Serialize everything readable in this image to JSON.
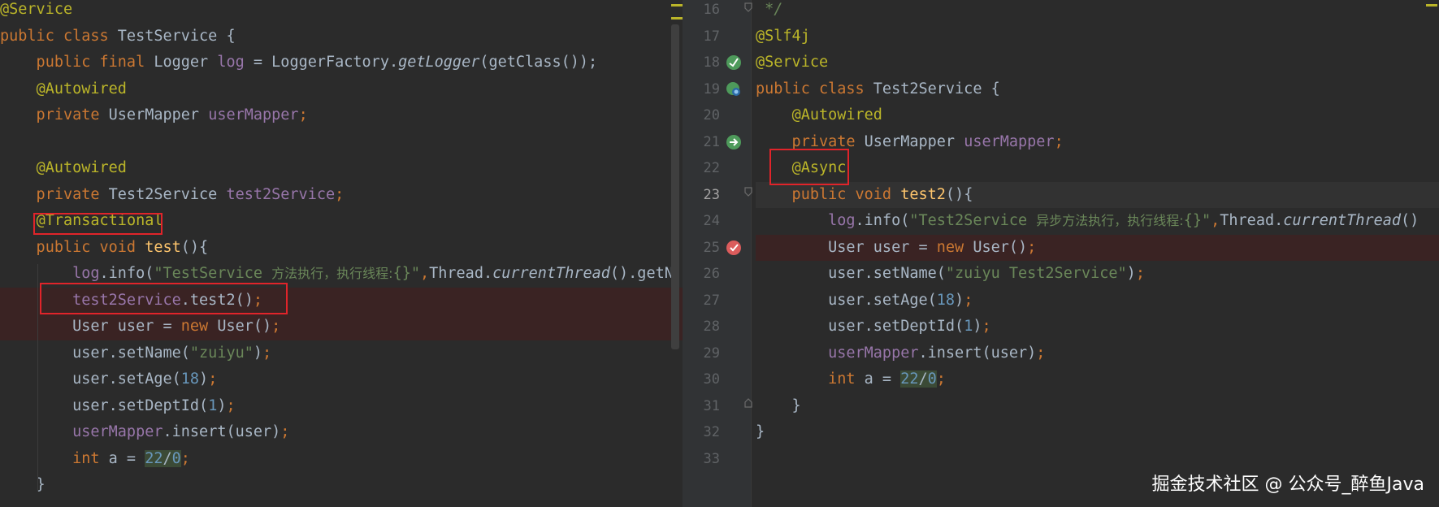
{
  "left_editor": {
    "lines": [
      {
        "tokens": [
          {
            "t": "@Service",
            "c": "ann"
          }
        ]
      },
      {
        "tokens": [
          {
            "t": "public class ",
            "c": "kw"
          },
          {
            "t": "TestService {",
            "c": "plain"
          }
        ]
      },
      {
        "tokens": [
          {
            "t": "    public final ",
            "c": "kw"
          },
          {
            "t": "Logger ",
            "c": "plain"
          },
          {
            "t": "log",
            "c": "fld"
          },
          {
            "t": " = LoggerFactory.",
            "c": "plain"
          },
          {
            "t": "getLogger",
            "c": "plain ital"
          },
          {
            "t": "(getClass());",
            "c": "plain"
          }
        ]
      },
      {
        "tokens": [
          {
            "t": "    ",
            "c": "plain"
          },
          {
            "t": "@Autowired",
            "c": "ann"
          }
        ]
      },
      {
        "tokens": [
          {
            "t": "    private ",
            "c": "kw"
          },
          {
            "t": "UserMapper ",
            "c": "plain"
          },
          {
            "t": "userMapper",
            "c": "fld"
          },
          {
            "t": ";",
            "c": "kw"
          }
        ]
      },
      {
        "tokens": []
      },
      {
        "tokens": [
          {
            "t": "    ",
            "c": "plain"
          },
          {
            "t": "@Autowired",
            "c": "ann"
          }
        ]
      },
      {
        "tokens": [
          {
            "t": "    private ",
            "c": "kw"
          },
          {
            "t": "Test2Service ",
            "c": "plain"
          },
          {
            "t": "test2Service",
            "c": "fld"
          },
          {
            "t": ";",
            "c": "kw"
          }
        ]
      },
      {
        "tokens": [
          {
            "t": "    ",
            "c": "plain"
          },
          {
            "t": "@Transactional",
            "c": "ann"
          }
        ]
      },
      {
        "tokens": [
          {
            "t": "    public void ",
            "c": "kw"
          },
          {
            "t": "test",
            "c": "fn"
          },
          {
            "t": "(){",
            "c": "plain"
          }
        ]
      },
      {
        "tokens": [
          {
            "t": "        ",
            "c": "plain"
          },
          {
            "t": "log",
            "c": "fld"
          },
          {
            "t": ".info(",
            "c": "plain"
          },
          {
            "t": "\"TestService ",
            "c": "str"
          },
          {
            "t": "方法执行，执行线程:",
            "c": "cn"
          },
          {
            "t": "{}\"",
            "c": "str"
          },
          {
            "t": ",",
            "c": "kw"
          },
          {
            "t": "Thread.",
            "c": "plain"
          },
          {
            "t": "currentThread",
            "c": "plain ital"
          },
          {
            "t": "().getN",
            "c": "plain"
          }
        ]
      },
      {
        "tokens": [
          {
            "t": "        ",
            "c": "plain"
          },
          {
            "t": "test2Service",
            "c": "fld"
          },
          {
            "t": ".test2()",
            "c": "plain"
          },
          {
            "t": ";",
            "c": "kw"
          }
        ],
        "bp": true
      },
      {
        "tokens": [
          {
            "t": "        User user = ",
            "c": "plain"
          },
          {
            "t": "new ",
            "c": "kw"
          },
          {
            "t": "User()",
            "c": "plain"
          },
          {
            "t": ";",
            "c": "kw"
          }
        ],
        "bp": true
      },
      {
        "tokens": [
          {
            "t": "        user.setName(",
            "c": "plain"
          },
          {
            "t": "\"zuiyu\"",
            "c": "str"
          },
          {
            "t": ")",
            "c": "plain"
          },
          {
            "t": ";",
            "c": "kw"
          }
        ]
      },
      {
        "tokens": [
          {
            "t": "        user.setAge(",
            "c": "plain"
          },
          {
            "t": "18",
            "c": "num"
          },
          {
            "t": ")",
            "c": "plain"
          },
          {
            "t": ";",
            "c": "kw"
          }
        ]
      },
      {
        "tokens": [
          {
            "t": "        user.setDeptId(",
            "c": "plain"
          },
          {
            "t": "1",
            "c": "num"
          },
          {
            "t": ")",
            "c": "plain"
          },
          {
            "t": ";",
            "c": "kw"
          }
        ]
      },
      {
        "tokens": [
          {
            "t": "        ",
            "c": "plain"
          },
          {
            "t": "userMapper",
            "c": "fld"
          },
          {
            "t": ".insert(user)",
            "c": "plain"
          },
          {
            "t": ";",
            "c": "kw"
          }
        ]
      },
      {
        "tokens": [
          {
            "t": "        int ",
            "c": "kw"
          },
          {
            "t": "a = ",
            "c": "plain"
          },
          {
            "t": "22",
            "c": "num hl-num"
          },
          {
            "t": "/",
            "c": "plain hl-num"
          },
          {
            "t": "0",
            "c": "num hl-num"
          },
          {
            "t": ";",
            "c": "kw"
          }
        ]
      },
      {
        "tokens": [
          {
            "t": "    }",
            "c": "plain"
          }
        ]
      }
    ]
  },
  "right_editor": {
    "line_numbers": [
      "16",
      "17",
      "18",
      "19",
      "20",
      "21",
      "22",
      "23",
      "24",
      "25",
      "26",
      "27",
      "28",
      "29",
      "30",
      "31",
      "32",
      "33"
    ],
    "current_line": "23",
    "lines": [
      {
        "tokens": [
          {
            "t": " */",
            "c": "str ital"
          }
        ]
      },
      {
        "tokens": [
          {
            "t": "@Slf4j",
            "c": "ann"
          }
        ]
      },
      {
        "tokens": [
          {
            "t": "@Service",
            "c": "ann"
          }
        ]
      },
      {
        "tokens": [
          {
            "t": "public class ",
            "c": "kw"
          },
          {
            "t": "Test2Service {",
            "c": "plain"
          }
        ]
      },
      {
        "tokens": [
          {
            "t": "    ",
            "c": "plain"
          },
          {
            "t": "@Autowired",
            "c": "ann"
          }
        ]
      },
      {
        "tokens": [
          {
            "t": "    private ",
            "c": "kw"
          },
          {
            "t": "UserMapper ",
            "c": "plain"
          },
          {
            "t": "userMapper",
            "c": "fld"
          },
          {
            "t": ";",
            "c": "kw"
          }
        ]
      },
      {
        "tokens": [
          {
            "t": "    ",
            "c": "plain"
          },
          {
            "t": "@Async",
            "c": "ann"
          }
        ]
      },
      {
        "tokens": [
          {
            "t": "    public void ",
            "c": "kw"
          },
          {
            "t": "test2",
            "c": "fn"
          },
          {
            "t": "(){",
            "c": "plain"
          }
        ],
        "cur": true
      },
      {
        "tokens": [
          {
            "t": "        ",
            "c": "plain"
          },
          {
            "t": "log",
            "c": "fld"
          },
          {
            "t": ".info(",
            "c": "plain"
          },
          {
            "t": "\"Test2Service ",
            "c": "str"
          },
          {
            "t": "异步方法执行，执行线程:",
            "c": "cn"
          },
          {
            "t": "{}\"",
            "c": "str"
          },
          {
            "t": ",",
            "c": "kw"
          },
          {
            "t": "Thread.",
            "c": "plain"
          },
          {
            "t": "currentThread",
            "c": "plain ital"
          },
          {
            "t": "()",
            "c": "plain"
          }
        ]
      },
      {
        "tokens": [
          {
            "t": "        User user = ",
            "c": "plain"
          },
          {
            "t": "new ",
            "c": "kw"
          },
          {
            "t": "User()",
            "c": "plain"
          },
          {
            "t": ";",
            "c": "kw"
          }
        ],
        "bp": true
      },
      {
        "tokens": [
          {
            "t": "        user.setName(",
            "c": "plain"
          },
          {
            "t": "\"zuiyu Test2Service\"",
            "c": "str"
          },
          {
            "t": ")",
            "c": "plain"
          },
          {
            "t": ";",
            "c": "kw"
          }
        ]
      },
      {
        "tokens": [
          {
            "t": "        user.setAge(",
            "c": "plain"
          },
          {
            "t": "18",
            "c": "num"
          },
          {
            "t": ")",
            "c": "plain"
          },
          {
            "t": ";",
            "c": "kw"
          }
        ]
      },
      {
        "tokens": [
          {
            "t": "        user.setDeptId(",
            "c": "plain"
          },
          {
            "t": "1",
            "c": "num"
          },
          {
            "t": ")",
            "c": "plain"
          },
          {
            "t": ";",
            "c": "kw"
          }
        ]
      },
      {
        "tokens": [
          {
            "t": "        ",
            "c": "plain"
          },
          {
            "t": "userMapper",
            "c": "fld"
          },
          {
            "t": ".insert(user)",
            "c": "plain"
          },
          {
            "t": ";",
            "c": "kw"
          }
        ]
      },
      {
        "tokens": [
          {
            "t": "        int ",
            "c": "kw"
          },
          {
            "t": "a = ",
            "c": "plain"
          },
          {
            "t": "22",
            "c": "num hl-num"
          },
          {
            "t": "/",
            "c": "plain hl-num"
          },
          {
            "t": "0",
            "c": "num hl-num"
          },
          {
            "t": ";",
            "c": "kw"
          }
        ]
      },
      {
        "tokens": [
          {
            "t": "    }",
            "c": "plain"
          }
        ]
      },
      {
        "tokens": [
          {
            "t": "}",
            "c": "plain"
          }
        ]
      },
      {
        "tokens": []
      }
    ],
    "gutter_icons": [
      {
        "line_index": 2,
        "name": "spring-bean-icon"
      },
      {
        "line_index": 3,
        "name": "spring-bean-search-icon"
      },
      {
        "line_index": 5,
        "name": "spring-autowire-icon"
      },
      {
        "line_index": 9,
        "name": "breakpoint-icon"
      }
    ]
  },
  "colors": {
    "background": "#2b2b2b",
    "annotation": "#bbb529",
    "keyword": "#cc7832",
    "field": "#9876aa",
    "string": "#6a8759",
    "number": "#6897bb",
    "method_decl": "#ffc66d",
    "highlight_box": "#e0242a",
    "breakpoint": "#db5c5c"
  },
  "watermark": "掘金技术社区 @ 公众号_醉鱼Java"
}
